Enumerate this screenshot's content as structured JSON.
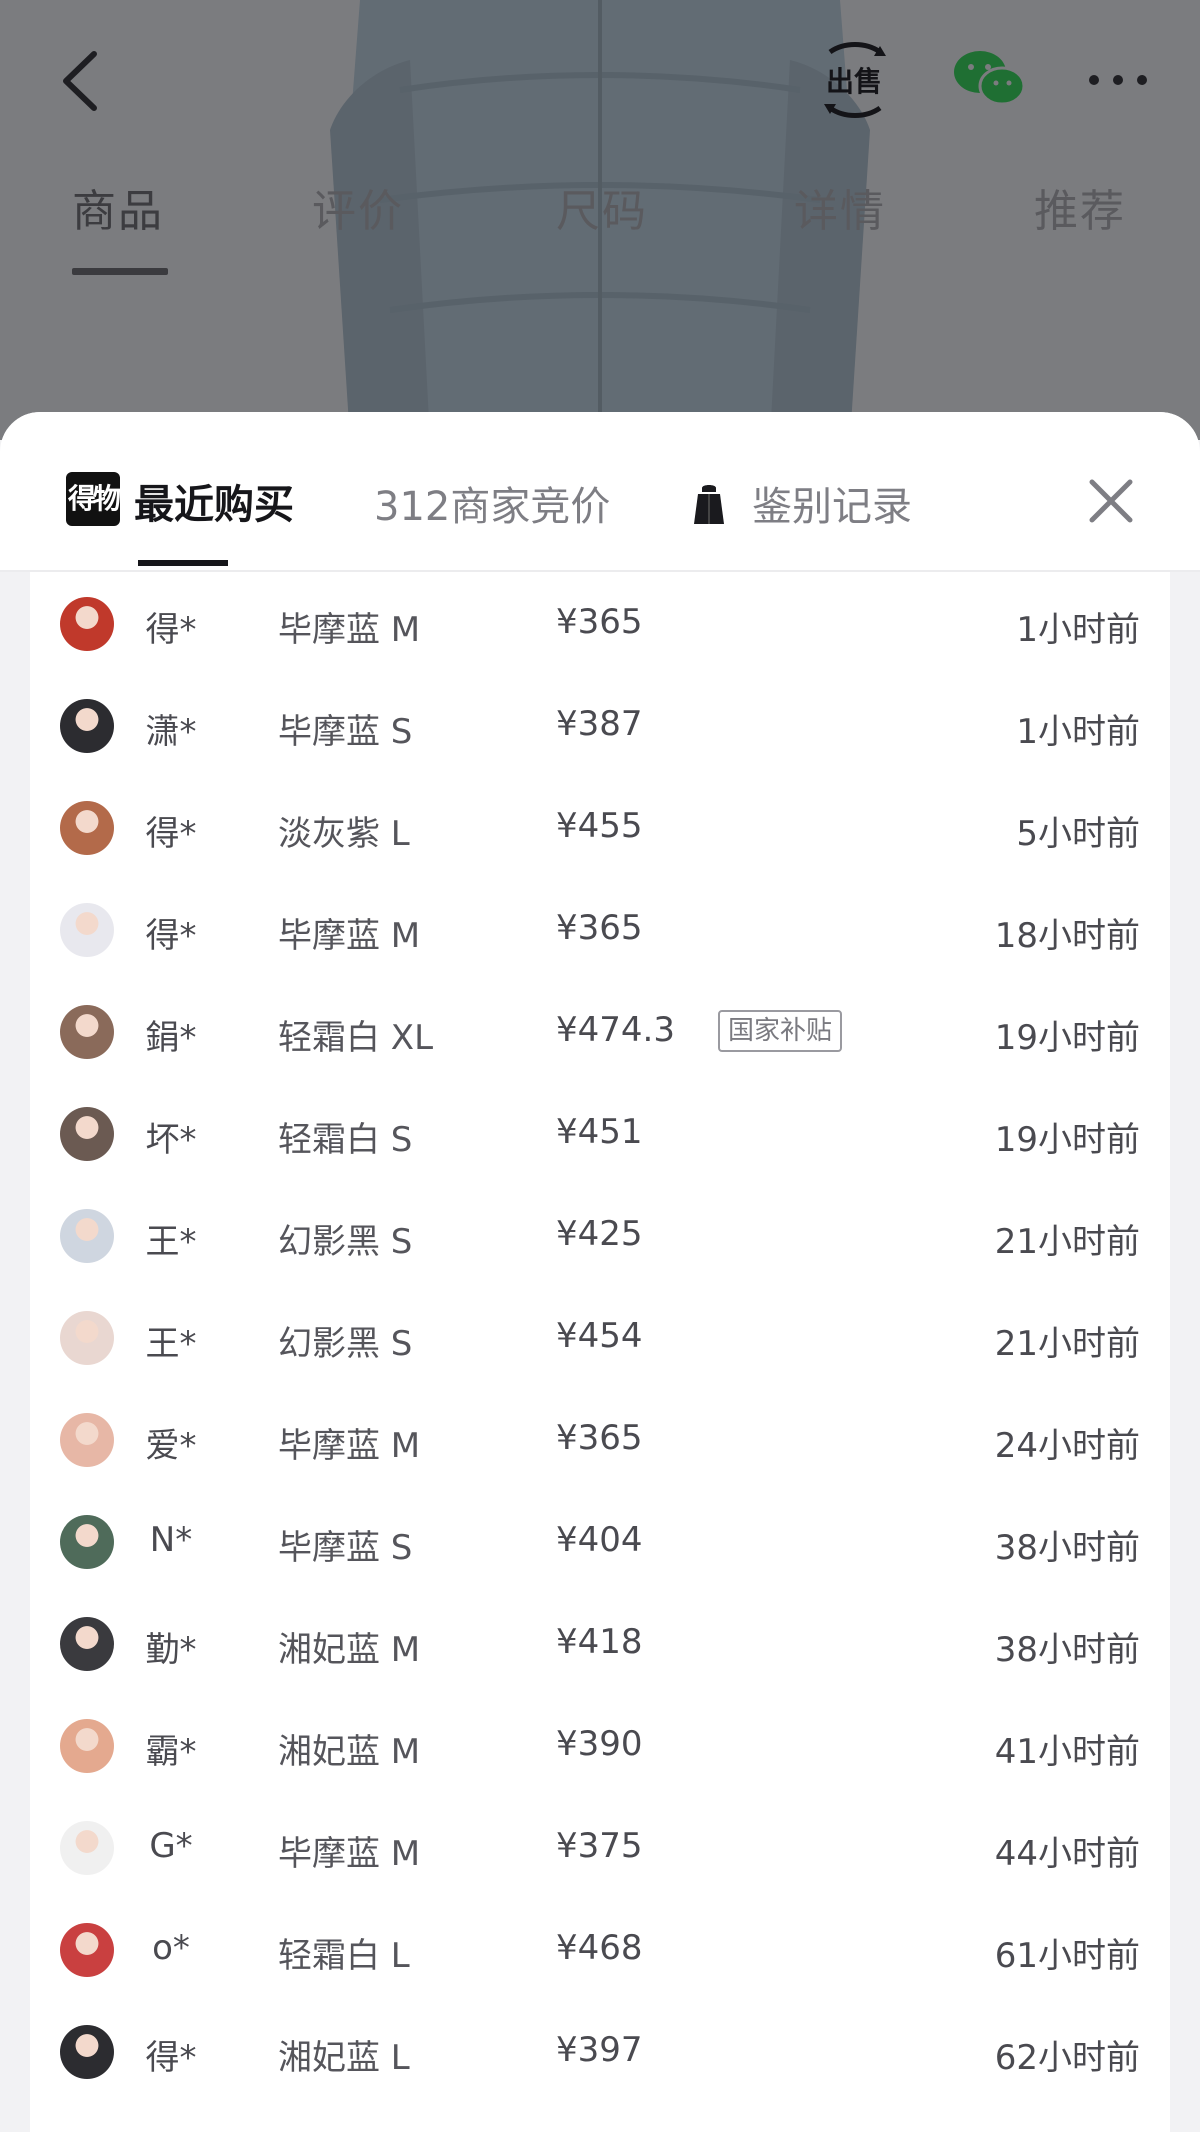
{
  "top_nav": {
    "back_icon": "chevron-left-icon",
    "sell_label": "出售",
    "wechat_icon": "wechat-icon",
    "more_icon": "more-horizontal-icon",
    "tabs": [
      "商品",
      "评价",
      "尺码",
      "详情",
      "推荐"
    ],
    "active_tab": "商品"
  },
  "sheet": {
    "tabs": {
      "recent_label": "最近购买",
      "bids_label": "312商家竞价",
      "auth_label": "鉴别记录"
    },
    "brand_logo_text": "得物",
    "close_icon": "close-icon"
  },
  "purchases": [
    {
      "name": "得*",
      "product": "毕摩蓝 M",
      "price": "¥365",
      "time": "1小时前"
    },
    {
      "name": "潇*",
      "product": "毕摩蓝 S",
      "price": "¥387",
      "time": "1小时前"
    },
    {
      "name": "得*",
      "product": "淡灰紫 L",
      "price": "¥455",
      "time": "5小时前"
    },
    {
      "name": "得*",
      "product": "毕摩蓝 M",
      "price": "¥365",
      "time": "18小时前"
    },
    {
      "name": "鋗*",
      "product": "轻霜白 XL",
      "price": "¥474.3",
      "badge": "国家补贴",
      "time": "19小时前"
    },
    {
      "name": "坏*",
      "product": "轻霜白 S",
      "price": "¥451",
      "time": "19小时前"
    },
    {
      "name": "王*",
      "product": "幻影黑 S",
      "price": "¥425",
      "time": "21小时前"
    },
    {
      "name": "王*",
      "product": "幻影黑 S",
      "price": "¥454",
      "time": "21小时前"
    },
    {
      "name": "爱*",
      "product": "毕摩蓝 M",
      "price": "¥365",
      "time": "24小时前"
    },
    {
      "name": "N*",
      "product": "毕摩蓝 S",
      "price": "¥404",
      "time": "38小时前"
    },
    {
      "name": "勤*",
      "product": "湘妃蓝 M",
      "price": "¥418",
      "time": "38小时前"
    },
    {
      "name": "霸*",
      "product": "湘妃蓝 M",
      "price": "¥390",
      "time": "41小时前"
    },
    {
      "name": "G*",
      "product": "毕摩蓝 M",
      "price": "¥375",
      "time": "44小时前"
    },
    {
      "name": "o*",
      "product": "轻霜白 L",
      "price": "¥468",
      "time": "61小时前"
    },
    {
      "name": "得*",
      "product": "湘妃蓝 L",
      "price": "¥397",
      "time": "62小时前"
    }
  ],
  "colors": {
    "dim_overlay": "#7b7c7f",
    "sheet_bg": "#ffffff",
    "text_primary": "#16161a",
    "text_secondary": "#7e7e84",
    "avatar_palette": [
      "#c0392b",
      "#2c2c30",
      "#b36a4a",
      "#e8e8ee",
      "#8a6a5a",
      "#6b5a52",
      "#cfd6e0",
      "#e9d7d1",
      "#e7b7a6",
      "#4f6b5a",
      "#3a3a3e",
      "#e4a98f",
      "#f0f0f0",
      "#c94040",
      "#2c2c30"
    ]
  }
}
